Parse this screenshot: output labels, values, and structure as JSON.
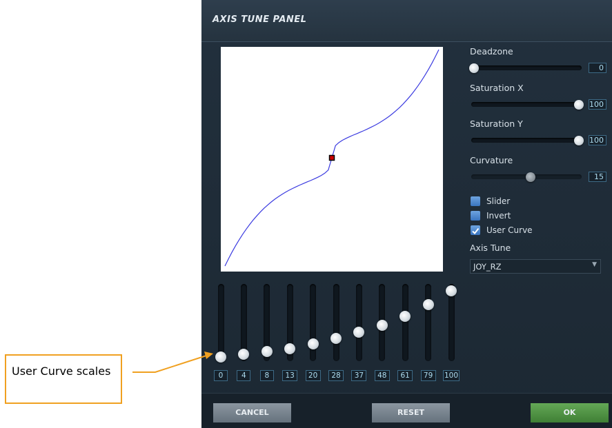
{
  "panel": {
    "title": "AXIS TUNE PANEL",
    "deadzone": {
      "label": "Deadzone",
      "value": "0",
      "level": 0.0
    },
    "saturation_x": {
      "label": "Saturation X",
      "value": "100",
      "level": 1.0
    },
    "saturation_y": {
      "label": "Saturation Y",
      "value": "100",
      "level": 1.0
    },
    "curvature": {
      "label": "Curvature",
      "value": "15",
      "level": 0.54,
      "disabled": true
    },
    "checkboxes": [
      {
        "label": "Slider",
        "checked": false
      },
      {
        "label": "Invert",
        "checked": false
      },
      {
        "label": "User Curve",
        "checked": true
      }
    ],
    "axis_tune": {
      "label": "Axis Tune",
      "selected": "JOY_RZ"
    },
    "user_curve": [
      {
        "value": "0",
        "level": 0.0
      },
      {
        "value": "4",
        "level": 0.04
      },
      {
        "value": "8",
        "level": 0.08
      },
      {
        "value": "13",
        "level": 0.13
      },
      {
        "value": "20",
        "level": 0.2
      },
      {
        "value": "28",
        "level": 0.28
      },
      {
        "value": "37",
        "level": 0.37
      },
      {
        "value": "48",
        "level": 0.48
      },
      {
        "value": "61",
        "level": 0.61
      },
      {
        "value": "79",
        "level": 0.79
      },
      {
        "value": "100",
        "level": 1.0
      }
    ],
    "buttons": {
      "cancel": "CANCEL",
      "reset": "RESET",
      "ok": "OK"
    }
  },
  "callout": {
    "text": "User Curve scales"
  },
  "colors": {
    "curve": "#3a3ae0",
    "marker": "#cc0000",
    "callout_border": "#f0a020",
    "ok_button": "#4f9444"
  }
}
